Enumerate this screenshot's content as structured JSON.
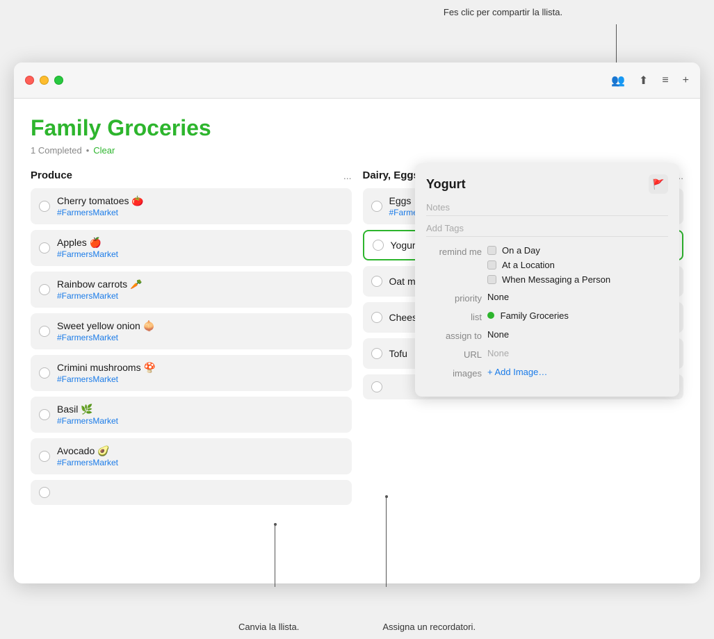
{
  "annotation_top": "Fes clic per compartir la llista.",
  "app": {
    "title": "Family Groceries",
    "completed_text": "1 Completed",
    "separator": "•",
    "clear_label": "Clear"
  },
  "columns": [
    {
      "title": "Produce",
      "dots": "...",
      "items": [
        {
          "text": "Cherry tomatoes 🍅",
          "tag": "#FarmersMarket",
          "checked": false
        },
        {
          "text": "Apples 🍎",
          "tag": "#FarmersMarket",
          "checked": false
        },
        {
          "text": "Rainbow carrots 🥕",
          "tag": "#FarmersMarket",
          "checked": false
        },
        {
          "text": "Sweet yellow onion 🧅",
          "tag": "#FarmersMarket",
          "checked": false
        },
        {
          "text": "Crimini mushrooms 🍄",
          "tag": "#FarmersMarket",
          "checked": false
        },
        {
          "text": "Basil 🌿",
          "tag": "#FarmersMarket",
          "checked": false
        },
        {
          "text": "Avocado 🥑",
          "tag": "#FarmersMarket",
          "checked": false
        }
      ]
    },
    {
      "title": "Dairy, Eggs & Chee…",
      "dots": "...",
      "items": [
        {
          "text": "Eggs 🥚",
          "tag": "#FarmersMarket",
          "checked": false
        },
        {
          "text": "Yogurt",
          "tag": "",
          "checked": false,
          "selected": true
        },
        {
          "text": "Oat milk",
          "tag": "",
          "checked": false
        },
        {
          "text": "Cheese 🧀",
          "tag": "",
          "checked": false
        },
        {
          "text": "Tofu",
          "tag": "",
          "checked": false
        }
      ]
    }
  ],
  "detail": {
    "title": "Yogurt",
    "flag_label": "🚩",
    "notes_placeholder": "Notes",
    "tags_placeholder": "Add Tags",
    "remind_label": "remind me",
    "remind_options": [
      "On a Day",
      "At a Location",
      "When Messaging a Person"
    ],
    "priority_label": "priority",
    "priority_value": "None",
    "list_label": "list",
    "list_value": "Family Groceries",
    "assign_label": "assign to",
    "assign_value": "None",
    "url_label": "URL",
    "url_value": "None",
    "images_label": "images",
    "add_image_label": "+ Add Image…"
  },
  "titlebar_icons": {
    "collab": "👥",
    "share": "⬆",
    "list": "≡",
    "add": "+"
  },
  "bottom": {
    "left_label": "Canvia la llista.",
    "right_label": "Assigna un recordatori."
  }
}
